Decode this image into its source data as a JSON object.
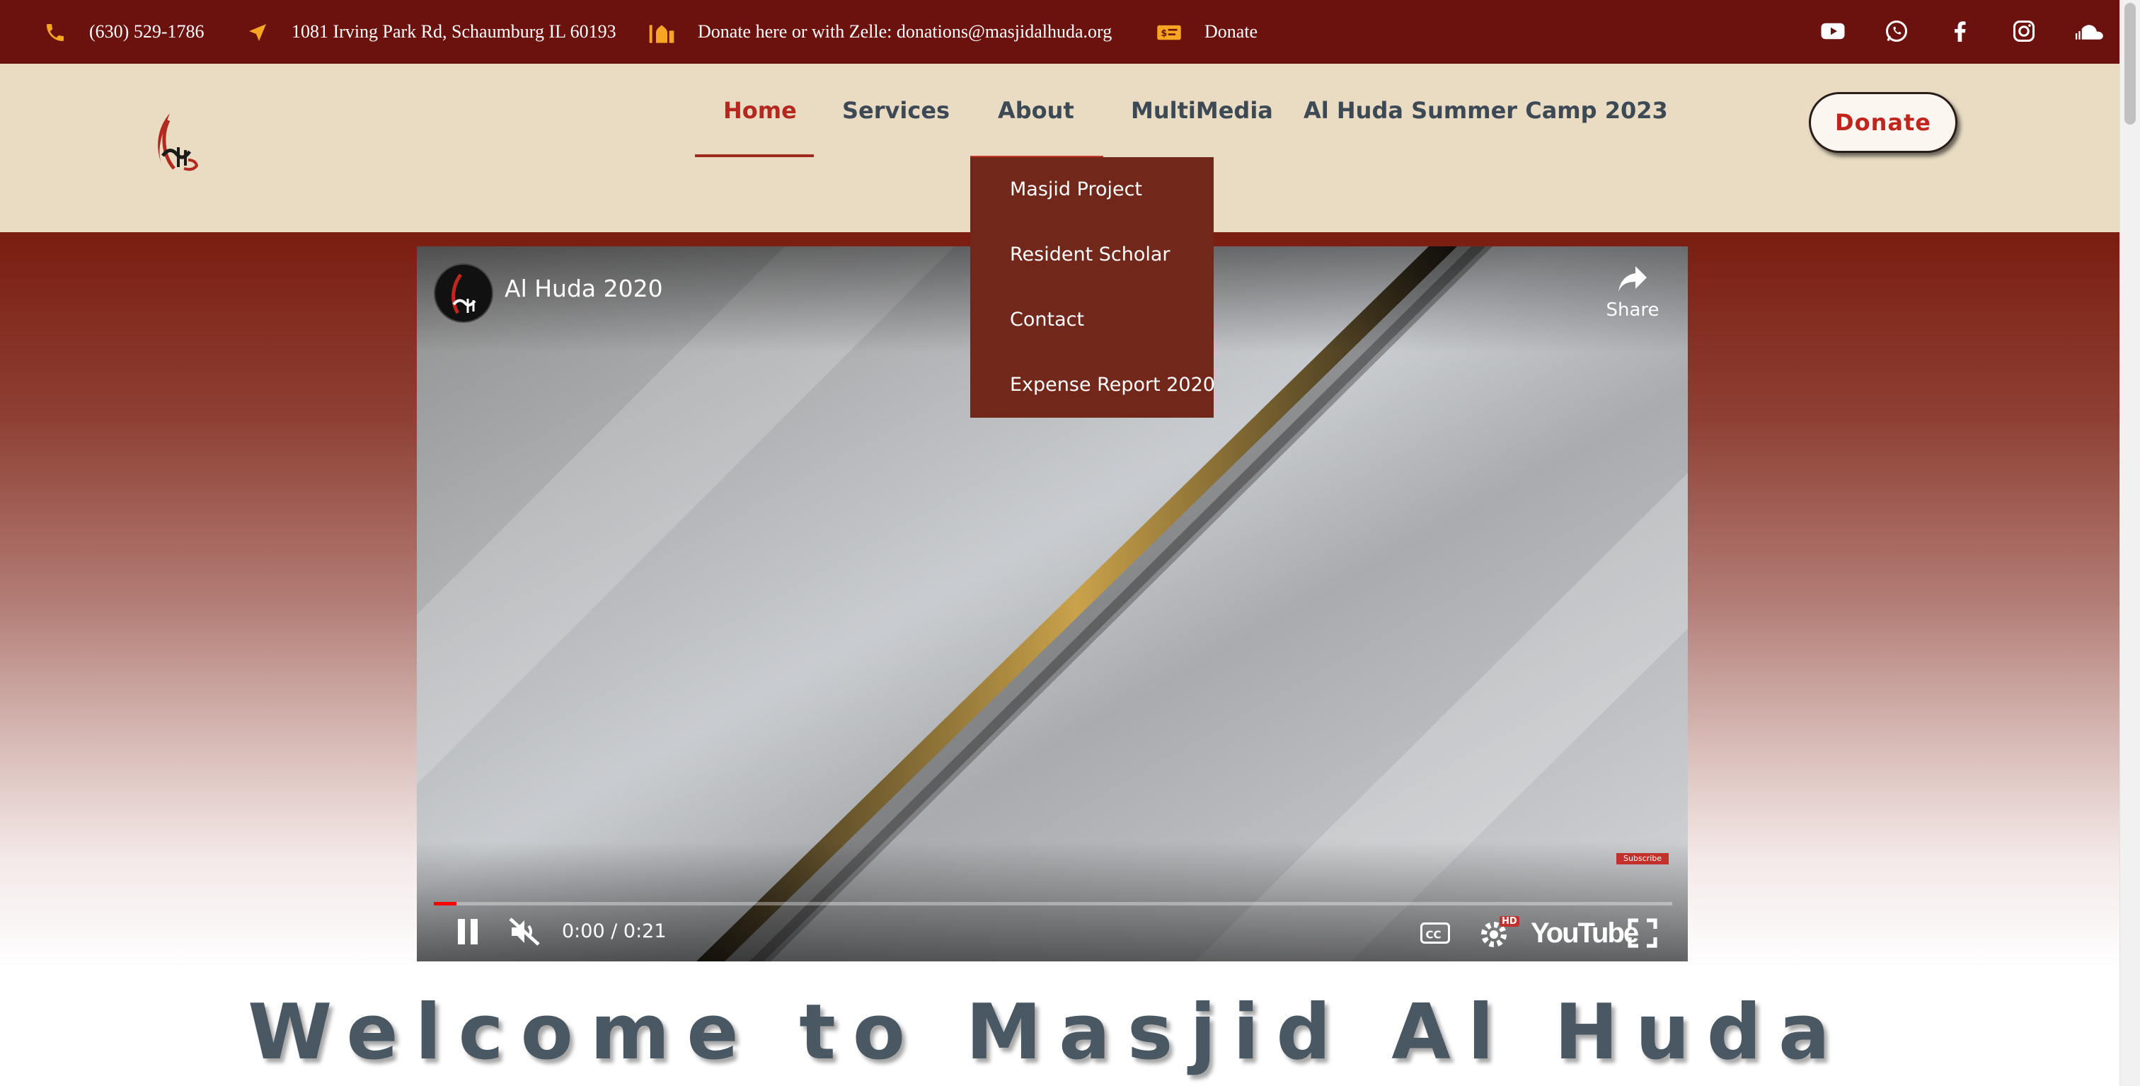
{
  "topbar": {
    "phone": "(630) 529-1786",
    "address": "1081 Irving Park Rd, Schaumburg IL 60193",
    "zelle": "Donate here or with Zelle: donations@masjidalhuda.org",
    "donate": "Donate",
    "icon_color": "#f6a623",
    "social_icons": [
      "youtube-icon",
      "whatsapp-icon",
      "facebook-icon",
      "instagram-icon",
      "soundcloud-icon"
    ]
  },
  "nav": {
    "items": [
      {
        "label": "Home",
        "active": true
      },
      {
        "label": "Services",
        "active": false
      },
      {
        "label": "About",
        "active": false
      },
      {
        "label": "MultiMedia",
        "active": false
      },
      {
        "label": "Al Huda Summer Camp 2023",
        "active": false
      }
    ],
    "donate_button": "Donate"
  },
  "about_dropdown": {
    "items": [
      "Masjid Project",
      "Resident Scholar",
      "Contact",
      "Expense Report 2020"
    ]
  },
  "video": {
    "title": "Al Huda 2020",
    "share_label": "Share",
    "subscribe_label": "Subscribe",
    "time": "0:00 / 0:21",
    "progress": 0.018,
    "platform": "YouTube",
    "hd_badge": "HD"
  },
  "welcome": {
    "heading": "Welcome to Masjid Al Huda"
  },
  "colors": {
    "topbar_bg": "#6b120f",
    "header_bg": "#e9dcc3",
    "accent": "#b3281f",
    "dropdown_bg": "#71271a"
  }
}
